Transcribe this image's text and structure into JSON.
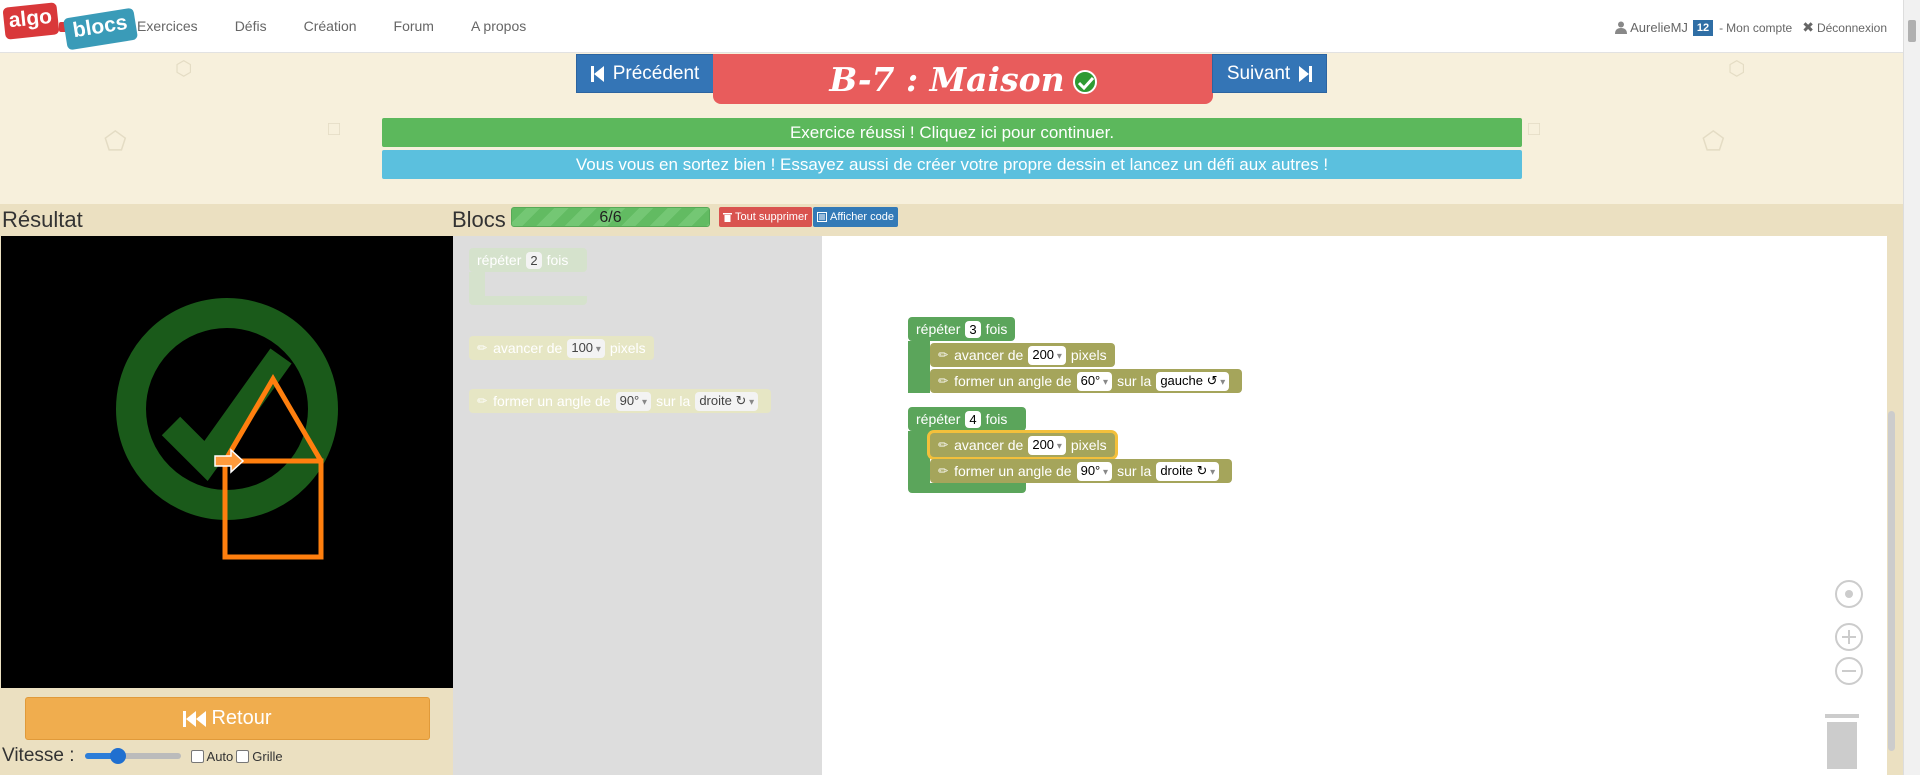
{
  "nav": {
    "logo_part1": "algo",
    "logo_part2": "blocs",
    "links": [
      "Exercices",
      "Défis",
      "Création",
      "Forum",
      "A propos"
    ],
    "user_name": "AurelieMJ",
    "user_badge": "12",
    "account_label": "Mon compte",
    "logout_label": "Déconnexion"
  },
  "header": {
    "prev_label": "Précédent",
    "next_label": "Suivant",
    "title": "B-7 : Maison",
    "success_message": "Exercice réussi ! Cliquez ici pour continuer.",
    "info_message": "Vous vous en sortez bien ! Essayez aussi de créer votre propre dessin et lancez un défi aux autres !"
  },
  "result": {
    "label": "Résultat",
    "retour_label": "Retour",
    "speed_label": "Vitesse :",
    "speed_level": 0.35,
    "auto_label": "Auto",
    "grid_label": "Grille"
  },
  "blocks_panel": {
    "label": "Blocs",
    "progress_text": "6/6",
    "delete_label": "Tout supprimer",
    "show_code_label": "Afficher code"
  },
  "toolbox": {
    "repeat": {
      "prefix": "répéter",
      "count": "2",
      "suffix": "fois"
    },
    "forward": {
      "prefix": "avancer de",
      "value": "100",
      "suffix": "pixels"
    },
    "turn": {
      "prefix": "former un angle de",
      "angle": "90°",
      "middle": "sur la",
      "direction": "droite ↻"
    }
  },
  "program": {
    "loop1": {
      "prefix": "répéter",
      "count": "3",
      "suffix": "fois"
    },
    "loop1_forward": {
      "prefix": "avancer de",
      "value": "200",
      "suffix": "pixels"
    },
    "loop1_turn": {
      "prefix": "former un angle de",
      "angle": "60°",
      "middle": "sur la",
      "direction": "gauche ↺"
    },
    "loop2": {
      "prefix": "répéter",
      "count": "4",
      "suffix": "fois"
    },
    "loop2_forward": {
      "prefix": "avancer de",
      "value": "200",
      "suffix": "pixels"
    },
    "loop2_turn": {
      "prefix": "former un angle de",
      "angle": "90°",
      "middle": "sur la",
      "direction": "droite ↻"
    }
  },
  "colors": {
    "loop_block": "#5ba55b",
    "action_block": "#a5a55b",
    "drawing_stroke": "#ff7f0e",
    "success_banner": "#5cb85c",
    "info_banner": "#5bc0de",
    "title_bg": "#e85c5c"
  }
}
